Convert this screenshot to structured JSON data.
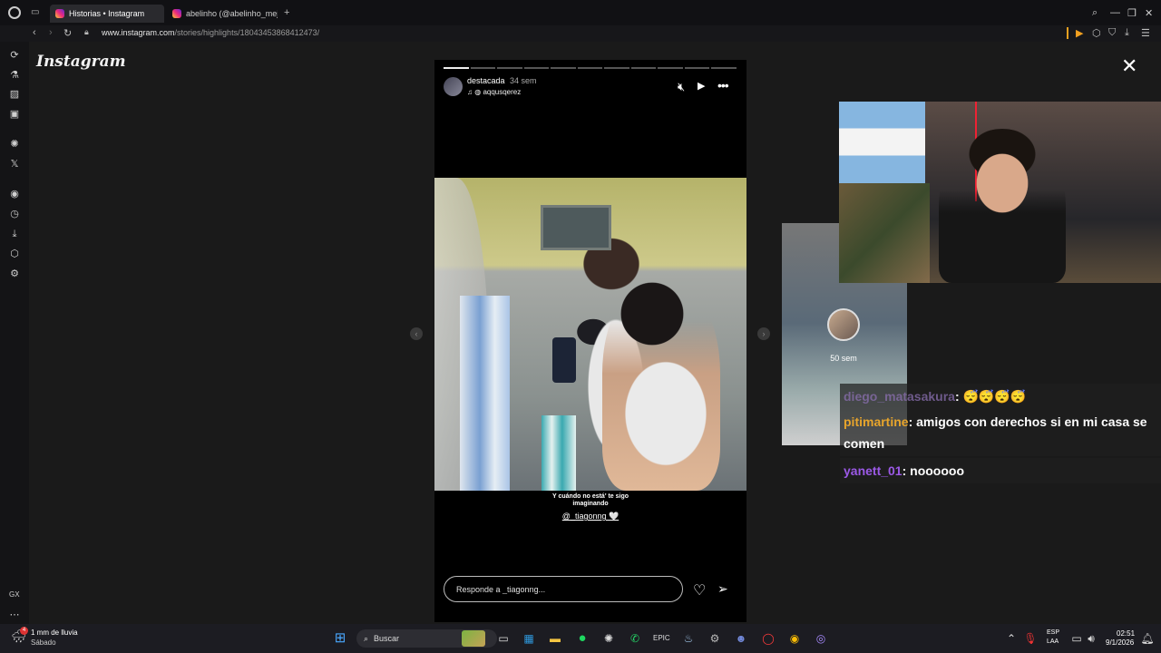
{
  "browser": {
    "tabs": [
      {
        "title": "Historias • Instagram",
        "active": true
      },
      {
        "title": "abelinho (@abelinho_mejo",
        "active": false
      }
    ],
    "new_tab_label": "+",
    "url_domain": "www.instagram.com",
    "url_path": "/stories/highlights/18043453868412473/",
    "sidebar_gx_label": "GX"
  },
  "instagram": {
    "logo": "Instagram",
    "story": {
      "user": "destacada",
      "time": "34 sem",
      "audio": "aqqusqerez",
      "caption": "Y cuándo no está' te sigo imaginando",
      "mention": "@_tiagonng 🤍",
      "reply_placeholder": "Responde a _tiagonng...",
      "segments": 11,
      "current_segment": 1
    },
    "next_preview_time": "50 sem"
  },
  "chat": [
    {
      "user": "diego_matasakura",
      "text": ": 😴😴😴😴",
      "color": "faded"
    },
    {
      "user": "pitimartine",
      "text": ": amigos con derechos si en mi casa se comen",
      "color": "orange"
    },
    {
      "user": "yanett_01",
      "text": ": noooooo",
      "color": "purple"
    }
  ],
  "taskbar": {
    "weather_temp": "1 mm de lluvia",
    "weather_day": "Sábado",
    "weather_badge": "4",
    "search_label": "Buscar",
    "lang_line1": "ESP",
    "lang_line2": "LAA",
    "time": "02:51",
    "date": "9/1/2026"
  },
  "colors": {
    "ig_gradient": [
      "#f9ce34",
      "#ee2a7b",
      "#6228d7"
    ],
    "chat_orange": "#e8a52c",
    "chat_purple": "#9b59e6"
  }
}
